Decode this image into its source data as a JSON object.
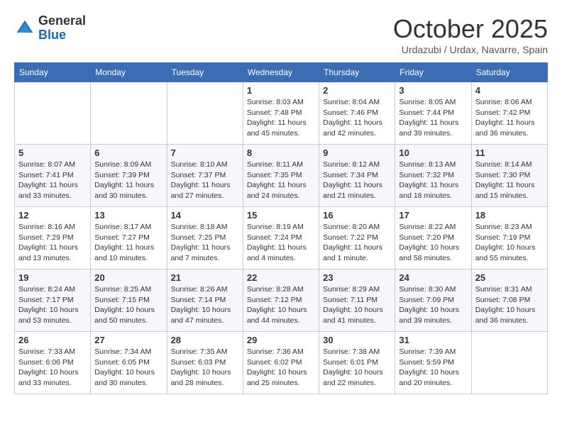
{
  "header": {
    "logo_general": "General",
    "logo_blue": "Blue",
    "month_title": "October 2025",
    "subtitle": "Urdazubi / Urdax, Navarre, Spain"
  },
  "days_of_week": [
    "Sunday",
    "Monday",
    "Tuesday",
    "Wednesday",
    "Thursday",
    "Friday",
    "Saturday"
  ],
  "weeks": [
    [
      {
        "day": "",
        "info": ""
      },
      {
        "day": "",
        "info": ""
      },
      {
        "day": "",
        "info": ""
      },
      {
        "day": "1",
        "info": "Sunrise: 8:03 AM\nSunset: 7:48 PM\nDaylight: 11 hours\nand 45 minutes."
      },
      {
        "day": "2",
        "info": "Sunrise: 8:04 AM\nSunset: 7:46 PM\nDaylight: 11 hours\nand 42 minutes."
      },
      {
        "day": "3",
        "info": "Sunrise: 8:05 AM\nSunset: 7:44 PM\nDaylight: 11 hours\nand 39 minutes."
      },
      {
        "day": "4",
        "info": "Sunrise: 8:06 AM\nSunset: 7:42 PM\nDaylight: 11 hours\nand 36 minutes."
      }
    ],
    [
      {
        "day": "5",
        "info": "Sunrise: 8:07 AM\nSunset: 7:41 PM\nDaylight: 11 hours\nand 33 minutes."
      },
      {
        "day": "6",
        "info": "Sunrise: 8:09 AM\nSunset: 7:39 PM\nDaylight: 11 hours\nand 30 minutes."
      },
      {
        "day": "7",
        "info": "Sunrise: 8:10 AM\nSunset: 7:37 PM\nDaylight: 11 hours\nand 27 minutes."
      },
      {
        "day": "8",
        "info": "Sunrise: 8:11 AM\nSunset: 7:35 PM\nDaylight: 11 hours\nand 24 minutes."
      },
      {
        "day": "9",
        "info": "Sunrise: 8:12 AM\nSunset: 7:34 PM\nDaylight: 11 hours\nand 21 minutes."
      },
      {
        "day": "10",
        "info": "Sunrise: 8:13 AM\nSunset: 7:32 PM\nDaylight: 11 hours\nand 18 minutes."
      },
      {
        "day": "11",
        "info": "Sunrise: 8:14 AM\nSunset: 7:30 PM\nDaylight: 11 hours\nand 15 minutes."
      }
    ],
    [
      {
        "day": "12",
        "info": "Sunrise: 8:16 AM\nSunset: 7:29 PM\nDaylight: 11 hours\nand 13 minutes."
      },
      {
        "day": "13",
        "info": "Sunrise: 8:17 AM\nSunset: 7:27 PM\nDaylight: 11 hours\nand 10 minutes."
      },
      {
        "day": "14",
        "info": "Sunrise: 8:18 AM\nSunset: 7:25 PM\nDaylight: 11 hours\nand 7 minutes."
      },
      {
        "day": "15",
        "info": "Sunrise: 8:19 AM\nSunset: 7:24 PM\nDaylight: 11 hours\nand 4 minutes."
      },
      {
        "day": "16",
        "info": "Sunrise: 8:20 AM\nSunset: 7:22 PM\nDaylight: 11 hours\nand 1 minute."
      },
      {
        "day": "17",
        "info": "Sunrise: 8:22 AM\nSunset: 7:20 PM\nDaylight: 10 hours\nand 58 minutes."
      },
      {
        "day": "18",
        "info": "Sunrise: 8:23 AM\nSunset: 7:19 PM\nDaylight: 10 hours\nand 55 minutes."
      }
    ],
    [
      {
        "day": "19",
        "info": "Sunrise: 8:24 AM\nSunset: 7:17 PM\nDaylight: 10 hours\nand 53 minutes."
      },
      {
        "day": "20",
        "info": "Sunrise: 8:25 AM\nSunset: 7:15 PM\nDaylight: 10 hours\nand 50 minutes."
      },
      {
        "day": "21",
        "info": "Sunrise: 8:26 AM\nSunset: 7:14 PM\nDaylight: 10 hours\nand 47 minutes."
      },
      {
        "day": "22",
        "info": "Sunrise: 8:28 AM\nSunset: 7:12 PM\nDaylight: 10 hours\nand 44 minutes."
      },
      {
        "day": "23",
        "info": "Sunrise: 8:29 AM\nSunset: 7:11 PM\nDaylight: 10 hours\nand 41 minutes."
      },
      {
        "day": "24",
        "info": "Sunrise: 8:30 AM\nSunset: 7:09 PM\nDaylight: 10 hours\nand 39 minutes."
      },
      {
        "day": "25",
        "info": "Sunrise: 8:31 AM\nSunset: 7:08 PM\nDaylight: 10 hours\nand 36 minutes."
      }
    ],
    [
      {
        "day": "26",
        "info": "Sunrise: 7:33 AM\nSunset: 6:06 PM\nDaylight: 10 hours\nand 33 minutes."
      },
      {
        "day": "27",
        "info": "Sunrise: 7:34 AM\nSunset: 6:05 PM\nDaylight: 10 hours\nand 30 minutes."
      },
      {
        "day": "28",
        "info": "Sunrise: 7:35 AM\nSunset: 6:03 PM\nDaylight: 10 hours\nand 28 minutes."
      },
      {
        "day": "29",
        "info": "Sunrise: 7:36 AM\nSunset: 6:02 PM\nDaylight: 10 hours\nand 25 minutes."
      },
      {
        "day": "30",
        "info": "Sunrise: 7:38 AM\nSunset: 6:01 PM\nDaylight: 10 hours\nand 22 minutes."
      },
      {
        "day": "31",
        "info": "Sunrise: 7:39 AM\nSunset: 5:59 PM\nDaylight: 10 hours\nand 20 minutes."
      },
      {
        "day": "",
        "info": ""
      }
    ]
  ]
}
